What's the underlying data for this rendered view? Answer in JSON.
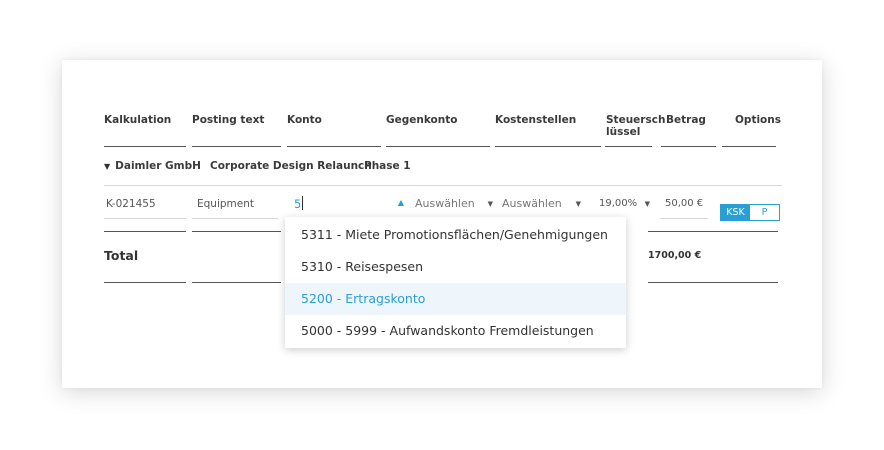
{
  "headers": [
    {
      "label": "Kalkulation"
    },
    {
      "label": "Posting text"
    },
    {
      "label": "Konto"
    },
    {
      "label": "Gegenkonto"
    },
    {
      "label": "Kostenstellen"
    },
    {
      "label": "Steuersch lüssel"
    },
    {
      "label": "Betrag"
    },
    {
      "label": "Options"
    }
  ],
  "group": {
    "client": "Daimler GmbH",
    "project": "Corporate Design Relaunch",
    "phase": "Phase 1",
    "expand_icon": "triangle-down-icon"
  },
  "row": {
    "kalkulation": "K-021455",
    "posting_text": "Equipment",
    "konto_input": "5",
    "gegenkonto": "Auswählen",
    "kostenstellen": "Auswählen",
    "steuer": "19,00%",
    "betrag": "50,00 €",
    "options": [
      "KSK",
      "P"
    ]
  },
  "total": {
    "label": "Total",
    "amount": "1700,00 €"
  },
  "dropdown": {
    "options": [
      "5311 - Miete Promotionsflächen/Genehmigungen",
      "5310 - Reisespesen",
      "5200 - Ertragskonto",
      "5000 - 5999 - Aufwandskonto Fremdleistungen"
    ],
    "selected": "5200 - Ertragskonto"
  },
  "colors": {
    "accent": "#2a9fd6",
    "selected_bg": "#eef5fb",
    "text": "#333333"
  }
}
